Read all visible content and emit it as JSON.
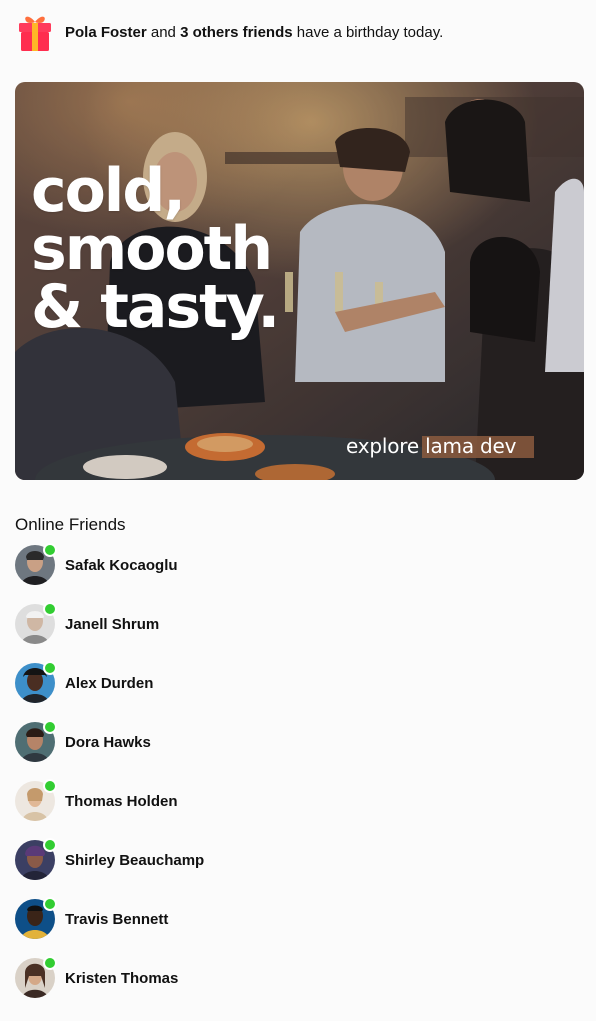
{
  "birthday": {
    "icon": "gift-icon",
    "name": "Pola Foster",
    "connector": "and",
    "others": "3 others friends",
    "suffix": "have a birthday today."
  },
  "ad": {
    "headline": [
      "cold,",
      "smooth",
      "& tasty."
    ],
    "brand": "explore lama dev"
  },
  "online_friends": {
    "title": "Online Friends",
    "status_color": "#32cd32",
    "items": [
      {
        "name": "Safak Kocaoglu"
      },
      {
        "name": "Janell Shrum"
      },
      {
        "name": "Alex Durden"
      },
      {
        "name": "Dora Hawks"
      },
      {
        "name": "Thomas Holden"
      },
      {
        "name": "Shirley Beauchamp"
      },
      {
        "name": "Travis Bennett"
      },
      {
        "name": "Kristen Thomas"
      }
    ]
  }
}
